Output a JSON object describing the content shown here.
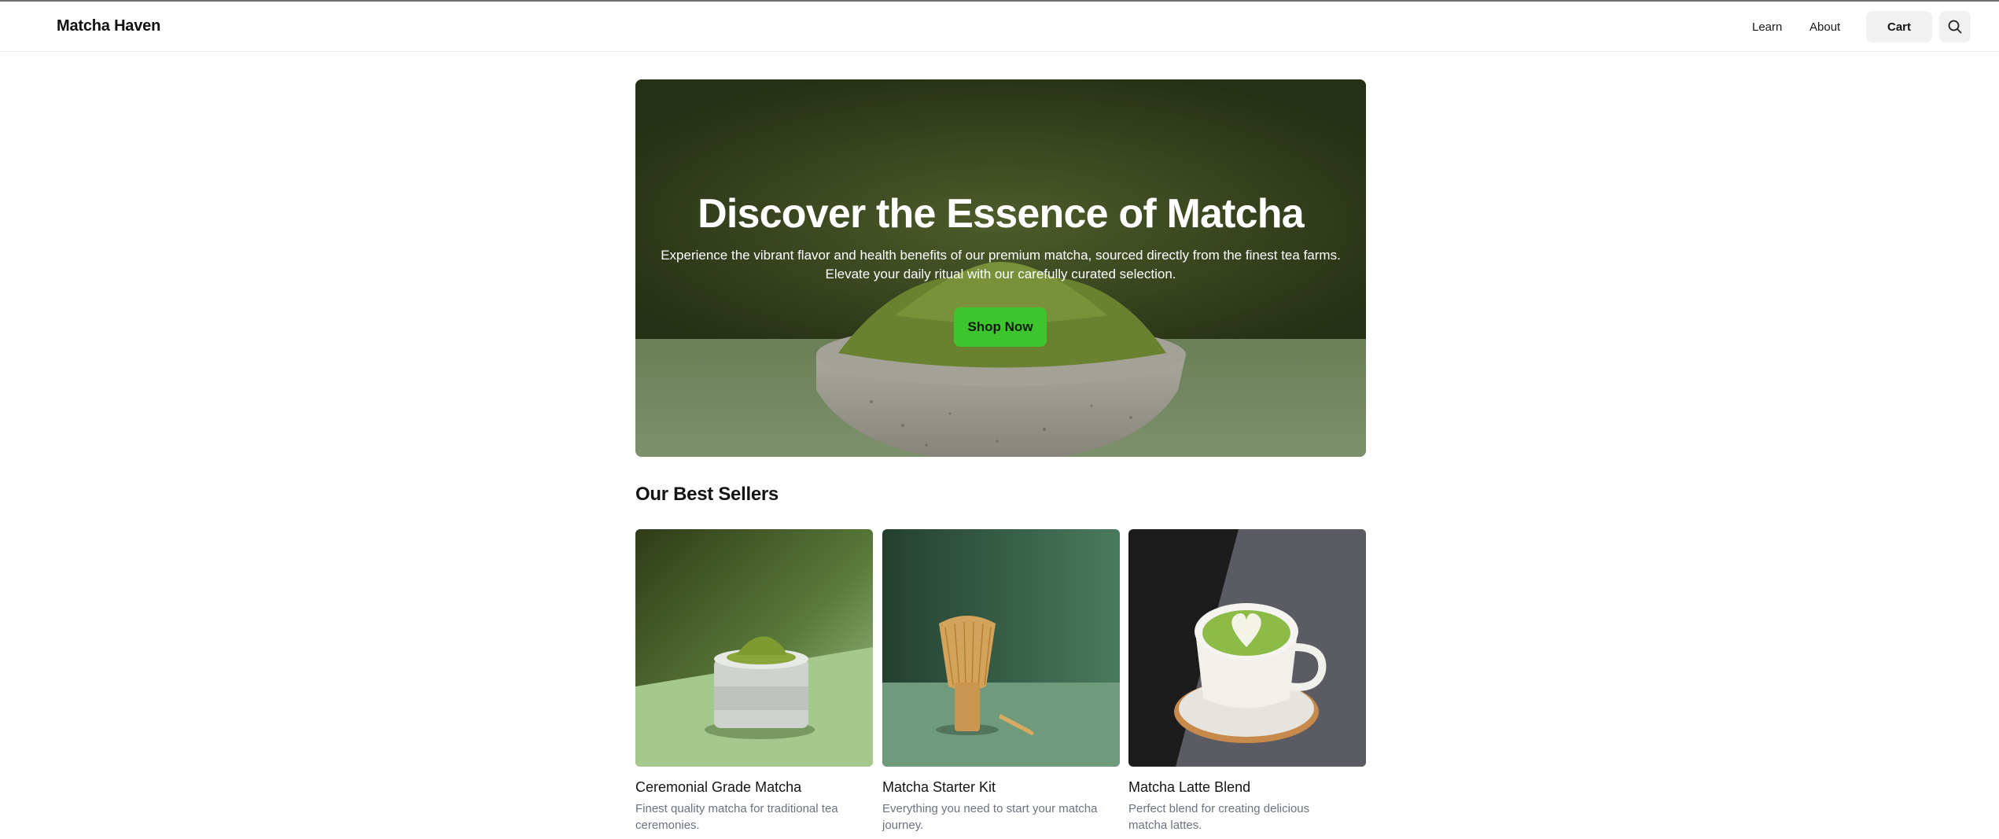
{
  "header": {
    "brand": "Matcha Haven",
    "nav": [
      {
        "label": "Learn"
      },
      {
        "label": "About"
      }
    ],
    "cart_label": "Cart",
    "search_icon": "search-icon"
  },
  "hero": {
    "title": "Discover the Essence of Matcha",
    "subtitle": "Experience the vibrant flavor and health benefits of our premium matcha, sourced directly from the finest tea farms. Elevate your daily ritual with our carefully curated selection.",
    "cta_label": "Shop Now",
    "cta_color": "#3cc52c"
  },
  "best_sellers": {
    "title": "Our Best Sellers",
    "products": [
      {
        "name": "Ceremonial Grade Matcha",
        "description": "Finest quality matcha for traditional tea ceremonies."
      },
      {
        "name": "Matcha Starter Kit",
        "description": "Everything you need to start your matcha journey."
      },
      {
        "name": "Matcha Latte Blend",
        "description": "Perfect blend for creating delicious matcha lattes."
      }
    ]
  },
  "colors": {
    "brand_green": "#3cc52c",
    "hero_dark": "#36441f"
  }
}
